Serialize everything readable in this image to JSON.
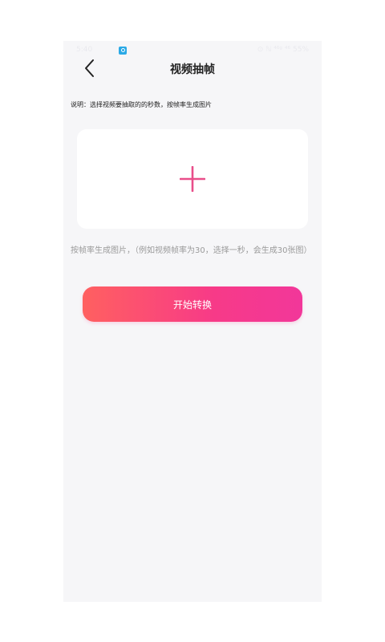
{
  "status_bar": {
    "time": "5:40",
    "right_text": "⊙ ℕ ⁴⁶ᵍ ⁴⁶ 55%"
  },
  "nav": {
    "title": "视频抽帧"
  },
  "hint": "说明：选择视频要抽取的的秒数，按帧率生成图片",
  "upload_card": {
    "icon": "plus-icon",
    "accent_color": "#e94e8a"
  },
  "note": "按帧率生成图片，（例如视频帧率为30，选择一秒，会生成30张图）",
  "start_button": {
    "label": "开始转换",
    "gradient_start": "#ff6060",
    "gradient_end": "#f2379a"
  }
}
